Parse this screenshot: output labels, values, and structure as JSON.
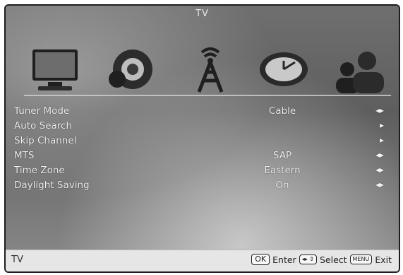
{
  "title": "TV",
  "icons": [
    {
      "name": "picture-icon"
    },
    {
      "name": "sound-icon"
    },
    {
      "name": "antenna-icon"
    },
    {
      "name": "time-clock-icon"
    },
    {
      "name": "parental-users-icon"
    }
  ],
  "rows": [
    {
      "label": "Tuner Mode",
      "value": "Cable",
      "arrow": "◂▸"
    },
    {
      "label": "Auto Search",
      "value": "",
      "arrow": "▸"
    },
    {
      "label": "Skip Channel",
      "value": "",
      "arrow": "▸"
    },
    {
      "label": "MTS",
      "value": "SAP",
      "arrow": "◂▸"
    },
    {
      "label": "Time Zone",
      "value": "Eastern",
      "arrow": "◂▸"
    },
    {
      "label": "Daylight Saving",
      "value": "On",
      "arrow": "◂▸"
    }
  ],
  "footer": {
    "left": "TV",
    "ok_key": "OK",
    "enter": "Enter",
    "nav_key": "◂▸ ⇕",
    "select": "Select",
    "menu_key": "MENU",
    "exit": "Exit"
  }
}
